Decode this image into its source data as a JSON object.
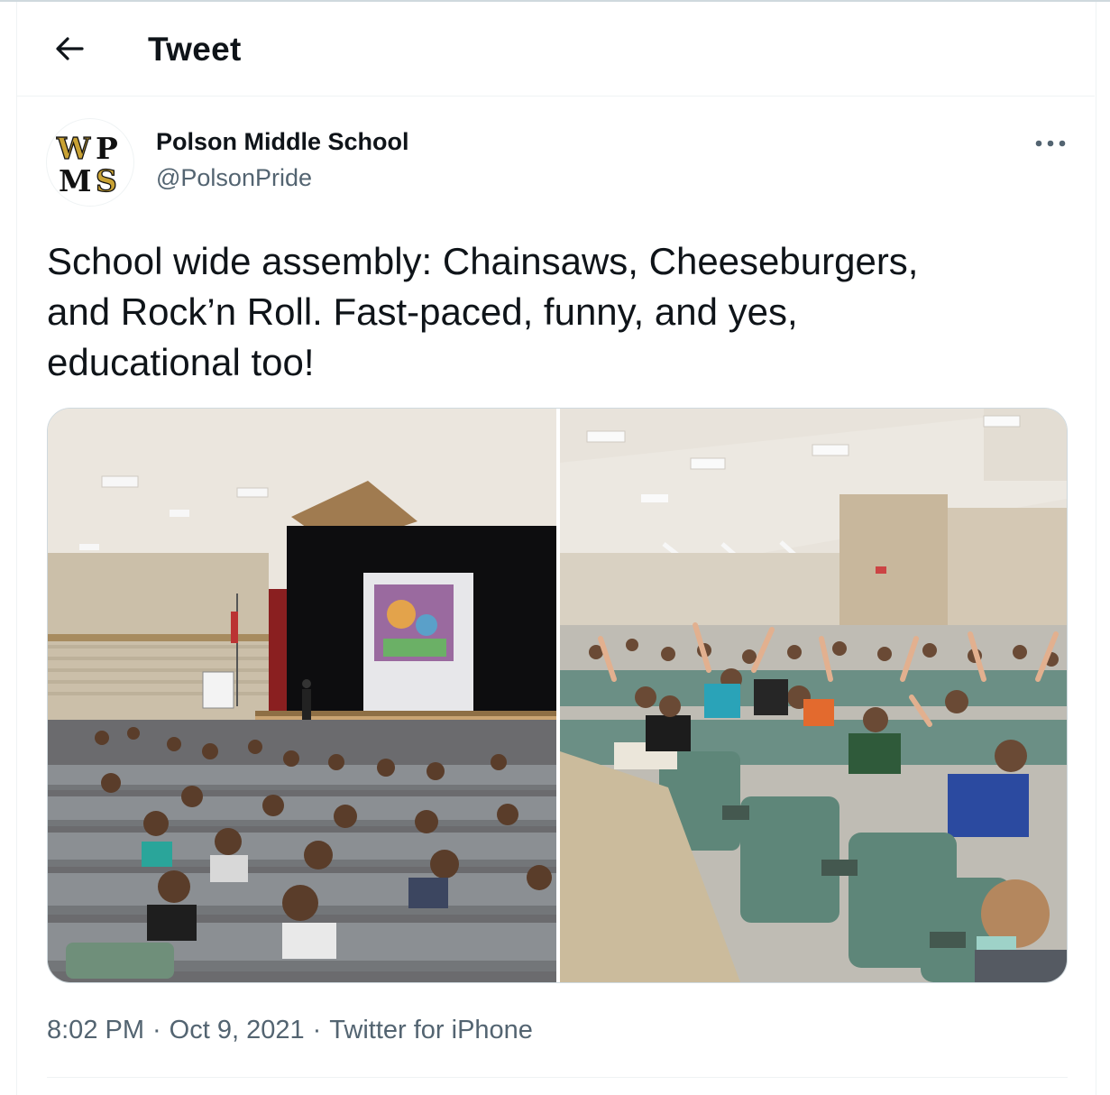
{
  "header": {
    "title": "Tweet",
    "back_icon": "arrow-left-icon"
  },
  "author": {
    "display_name": "Polson Middle School",
    "handle": "@PolsonPride",
    "avatar_logo": "WPMS",
    "avatar_colors": {
      "gold": "#c9a234",
      "black": "#111111"
    }
  },
  "tweet": {
    "text_line1": "School wide assembly: Chainsaws, Cheeseburgers,",
    "text_line2": "and Rock’n Roll. Fast-paced, funny, and yes,",
    "text_line3": "educational too!"
  },
  "media": {
    "photos": [
      {
        "name": "auditorium-stage-photo"
      },
      {
        "name": "auditorium-audience-photo"
      }
    ]
  },
  "meta": {
    "time": "8:02 PM",
    "separator": "·",
    "date": "Oct 9, 2021",
    "source": "Twitter for iPhone"
  },
  "colors": {
    "text_primary": "#0f1419",
    "text_secondary": "#536471",
    "border": "#eff3f4",
    "media_border": "#cfd9de"
  }
}
